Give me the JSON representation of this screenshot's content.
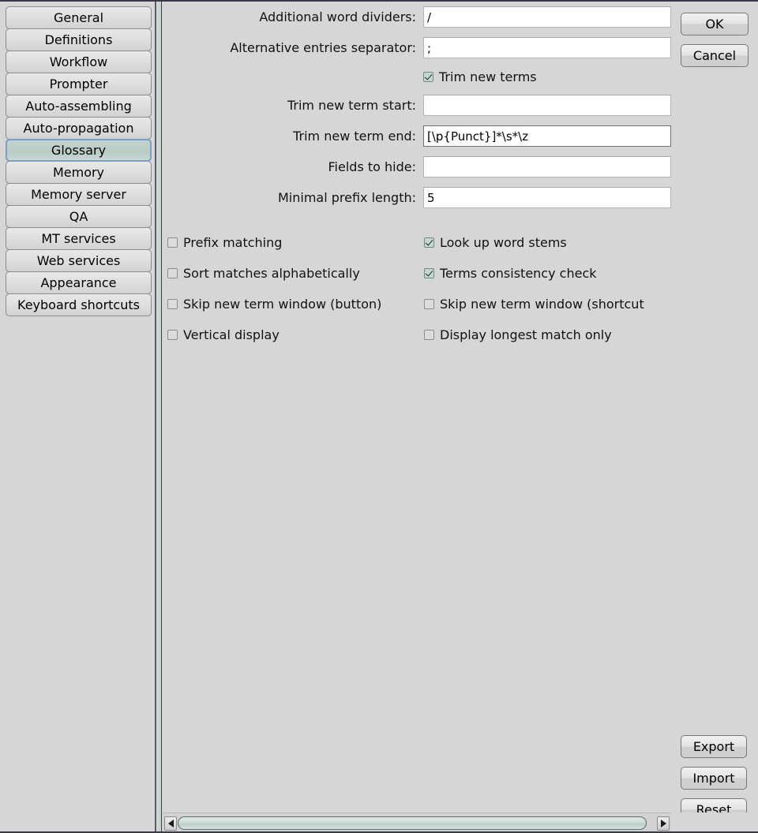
{
  "sidebar": {
    "items": [
      {
        "label": "General",
        "selected": false
      },
      {
        "label": "Definitions",
        "selected": false
      },
      {
        "label": "Workflow",
        "selected": false
      },
      {
        "label": "Prompter",
        "selected": false
      },
      {
        "label": "Auto-assembling",
        "selected": false
      },
      {
        "label": "Auto-propagation",
        "selected": false
      },
      {
        "label": "Glossary",
        "selected": true
      },
      {
        "label": "Memory",
        "selected": false
      },
      {
        "label": "Memory server",
        "selected": false
      },
      {
        "label": "QA",
        "selected": false
      },
      {
        "label": "MT services",
        "selected": false
      },
      {
        "label": "Web services",
        "selected": false
      },
      {
        "label": "Appearance",
        "selected": false
      },
      {
        "label": "Keyboard shortcuts",
        "selected": false
      }
    ]
  },
  "form": {
    "fields": [
      {
        "label": "Additional word dividers:",
        "value": "/",
        "focused": false
      },
      {
        "label": "Alternative entries separator:",
        "value": ";",
        "focused": false
      },
      {
        "label": "Trim new term start:",
        "value": "",
        "focused": false
      },
      {
        "label": "Trim new term end:",
        "value": "[\\p{Punct}]*\\s*\\z",
        "focused": true
      },
      {
        "label": "Fields to hide:",
        "value": "",
        "focused": false
      },
      {
        "label": "Minimal prefix length:",
        "value": "5",
        "focused": false
      }
    ],
    "trim_new_terms": {
      "label": "Trim new terms",
      "checked": true
    }
  },
  "options": {
    "rows": [
      [
        {
          "label": "Prefix matching",
          "checked": false
        },
        {
          "label": "Look up word stems",
          "checked": true
        }
      ],
      [
        {
          "label": "Sort matches alphabetically",
          "checked": false
        },
        {
          "label": "Terms consistency check",
          "checked": true
        }
      ],
      [
        {
          "label": "Skip new term window (button)",
          "checked": false
        },
        {
          "label": "Skip new term window (shortcut",
          "checked": false
        }
      ],
      [
        {
          "label": "Vertical display",
          "checked": false
        },
        {
          "label": "Display longest match only",
          "checked": false
        }
      ]
    ]
  },
  "buttons": {
    "ok": "OK",
    "cancel": "Cancel",
    "export": "Export",
    "import": "Import",
    "reset": "Reset"
  },
  "scrollbar": {
    "left_arrow_icon": "triangle-left-icon",
    "right_arrow_icon": "triangle-right-icon",
    "thumb_position_percent": 0
  },
  "colors": {
    "window_bg": "#d6d6d6",
    "selected_tab_bg": "#c3d2cd",
    "selected_tab_border": "#7d9fc0",
    "checkbox_checked_bg": "#c6d6cf",
    "splitter": "#c2d0cb",
    "frame": "#3a3a46"
  }
}
